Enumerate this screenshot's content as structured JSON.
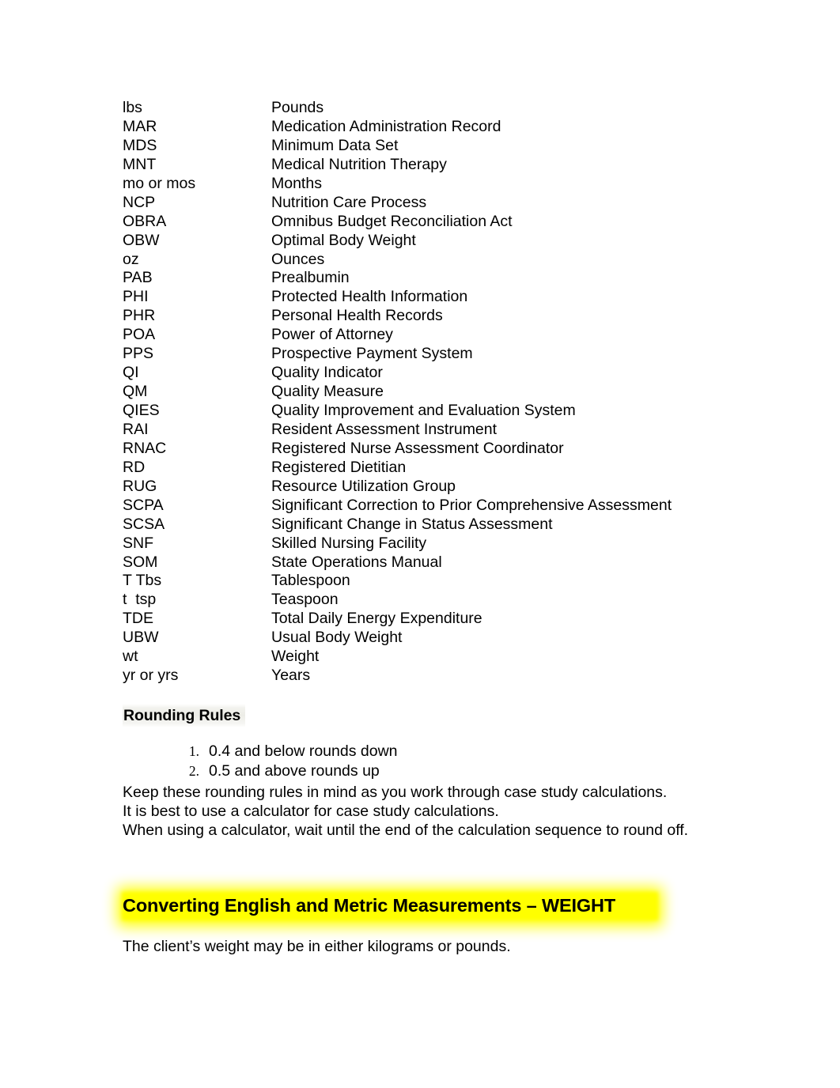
{
  "document": {
    "abbreviations": [
      {
        "term": "lbs",
        "definition": "Pounds"
      },
      {
        "term": "MAR",
        "definition": "Medication Administration Record"
      },
      {
        "term": "MDS",
        "definition": "Minimum Data Set"
      },
      {
        "term": "MNT",
        "definition": "Medical Nutrition Therapy"
      },
      {
        "term": "mo or mos",
        "definition": "Months"
      },
      {
        "term": "NCP",
        "definition": "Nutrition Care Process"
      },
      {
        "term": "OBRA",
        "definition": "Omnibus Budget Reconciliation Act"
      },
      {
        "term": "OBW",
        "definition": "Optimal Body Weight"
      },
      {
        "term": "oz",
        "definition": "Ounces"
      },
      {
        "term": "PAB",
        "definition": "Prealbumin"
      },
      {
        "term": "PHI",
        "definition": "Protected Health Information"
      },
      {
        "term": "PHR",
        "definition": "Personal Health Records"
      },
      {
        "term": "POA",
        "definition": "Power of Attorney"
      },
      {
        "term": "PPS",
        "definition": "Prospective Payment System"
      },
      {
        "term": "QI",
        "definition": "Quality Indicator"
      },
      {
        "term": "QM",
        "definition": "Quality Measure"
      },
      {
        "term": "QIES",
        "definition": "Quality Improvement and Evaluation System"
      },
      {
        "term": "RAI",
        "definition": "Resident Assessment Instrument"
      },
      {
        "term": "RNAC",
        "definition": "Registered Nurse Assessment Coordinator"
      },
      {
        "term": "RD",
        "definition": "Registered Dietitian"
      },
      {
        "term": "RUG",
        "definition": "Resource Utilization Group"
      },
      {
        "term": "SCPA",
        "definition": "Significant Correction to Prior Comprehensive Assessment"
      },
      {
        "term": "SCSA",
        "definition": "Significant Change in Status Assessment"
      },
      {
        "term": "SNF",
        "definition": "Skilled Nursing Facility"
      },
      {
        "term": "SOM",
        "definition": "State Operations Manual"
      },
      {
        "term": "T Tbs",
        "definition": "Tablespoon"
      },
      {
        "term": "t  tsp",
        "definition": "Teaspoon"
      },
      {
        "term": "TDE",
        "definition": "Total Daily Energy Expenditure"
      },
      {
        "term": "UBW",
        "definition": "Usual Body Weight"
      },
      {
        "term": "wt",
        "definition": "Weight"
      },
      {
        "term": "yr or yrs",
        "definition": "Years"
      }
    ],
    "rounding_section": {
      "heading": "Rounding Rules",
      "rules": [
        {
          "number": "1.",
          "text": "0.4 and below rounds down"
        },
        {
          "number": "2.",
          "text": "0.5 and above rounds up"
        }
      ],
      "paragraph_lines": [
        "Keep these rounding rules in mind as you work through case study calculations.",
        "It is best to use a calculator for case study calculations.",
        "When using a calculator, wait until the end of the calculation sequence to round off."
      ]
    },
    "conversion_section": {
      "heading": "Converting English and Metric Measurements – WEIGHT",
      "highlight_color": "#ffff00",
      "body": "The client’s weight may be in either kilograms or pounds."
    }
  }
}
